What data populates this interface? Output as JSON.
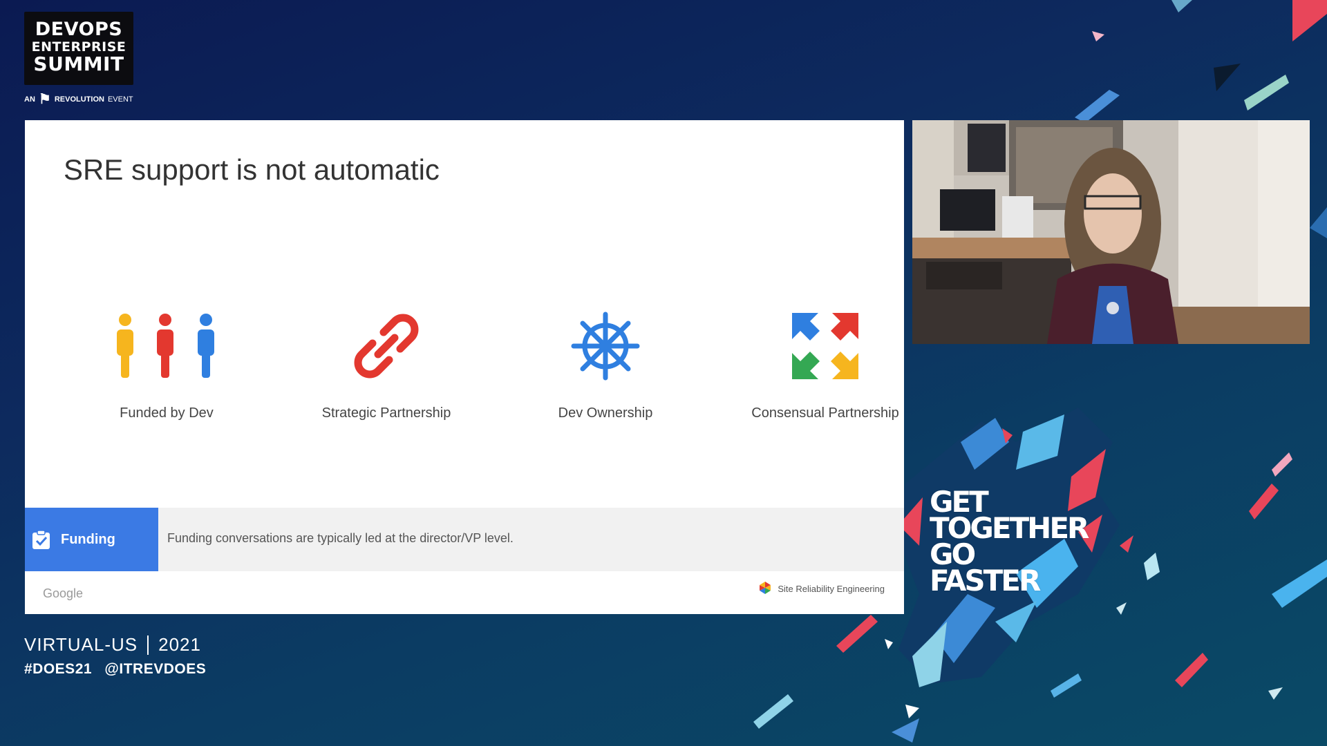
{
  "branding": {
    "logo_line1": "DEVOPS",
    "logo_line2": "ENTERPRISE",
    "logo_line3": "SUMMIT",
    "sub_an": "AN",
    "sub_name": "REVOLUTION",
    "sub_event": "EVENT"
  },
  "slide": {
    "title": "SRE support is not automatic",
    "features": [
      {
        "label": "Funded by Dev",
        "icon": "people-icon"
      },
      {
        "label": "Strategic Partnership",
        "icon": "link-icon"
      },
      {
        "label": "Dev Ownership",
        "icon": "ship-wheel-icon"
      },
      {
        "label": "Consensual Partnership",
        "icon": "arrows-icon"
      }
    ],
    "badge_label": "Funding",
    "note": "Funding conversations are typically led at the director/VP level.",
    "footer_left": "Google",
    "footer_right": "Site Reliability Engineering"
  },
  "event": {
    "name": "VIRTUAL-US",
    "year": "2021",
    "hashtag": "#DOES21",
    "handle": "@ITREVDOES"
  },
  "tagline": {
    "line1": "GET",
    "line2": "TOGETHER",
    "line3": "GO",
    "line4": "FASTER"
  },
  "colors": {
    "badge_blue": "#3b7ae4",
    "yellow": "#f6b51e",
    "red": "#e3382f",
    "blue": "#2f7fe0",
    "green": "#34a853"
  }
}
